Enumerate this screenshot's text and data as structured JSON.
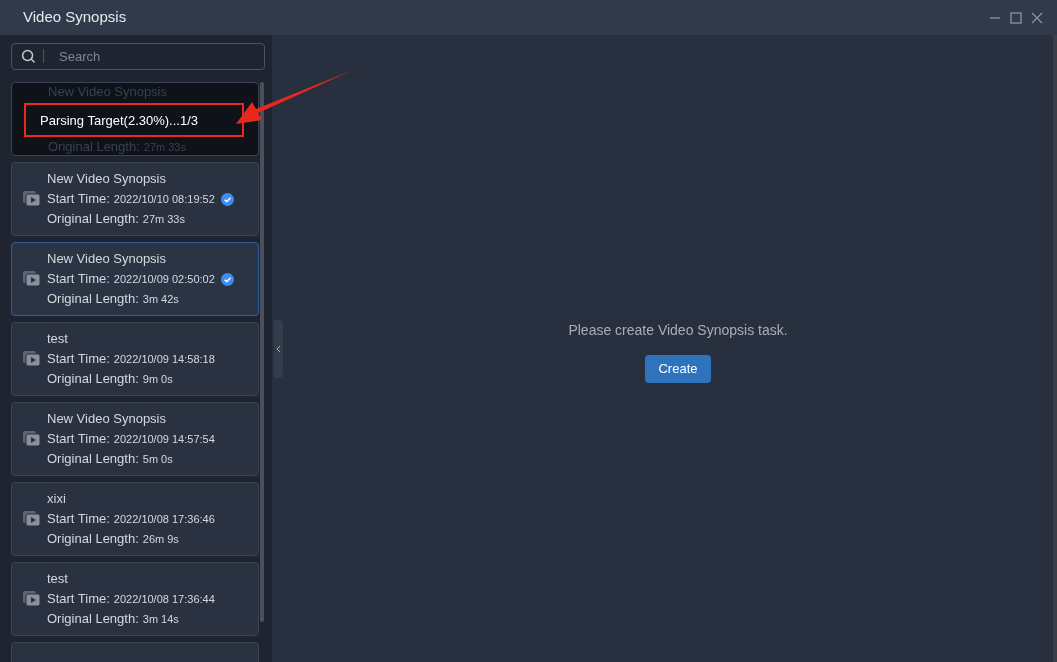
{
  "window": {
    "title": "Video Synopsis"
  },
  "search": {
    "placeholder": "Search"
  },
  "tasks": [
    {
      "name": "New Video Synopsis",
      "length_label": "Original Length:",
      "length": "27m 33s",
      "processing": true,
      "progress_text": "Parsing Target(2.30%)...1/3",
      "checked": false,
      "selected": false
    },
    {
      "name": "New Video Synopsis",
      "start_label": "Start Time:",
      "start_time": "2022/10/10 08:19:52",
      "length_label": "Original Length:",
      "length": "27m 33s",
      "processing": false,
      "checked": true,
      "selected": false
    },
    {
      "name": "New Video Synopsis",
      "start_label": "Start Time:",
      "start_time": "2022/10/09 02:50:02",
      "length_label": "Original Length:",
      "length": "3m 42s",
      "processing": false,
      "checked": true,
      "selected": true
    },
    {
      "name": "test",
      "start_label": "Start Time:",
      "start_time": "2022/10/09 14:58:18",
      "length_label": "Original Length:",
      "length": "9m 0s",
      "processing": false,
      "checked": false,
      "selected": false
    },
    {
      "name": "New Video Synopsis",
      "start_label": "Start Time:",
      "start_time": "2022/10/09 14:57:54",
      "length_label": "Original Length:",
      "length": "5m 0s",
      "processing": false,
      "checked": false,
      "selected": false
    },
    {
      "name": "xixi",
      "start_label": "Start Time:",
      "start_time": "2022/10/08 17:36:46",
      "length_label": "Original Length:",
      "length": "26m 9s",
      "processing": false,
      "checked": false,
      "selected": false
    },
    {
      "name": "test",
      "start_label": "Start Time:",
      "start_time": "2022/10/08 17:36:44",
      "length_label": "Original Length:",
      "length": "3m 14s",
      "processing": false,
      "checked": false,
      "selected": false
    }
  ],
  "empty_state": {
    "message": "Please create Video Synopsis task.",
    "button": "Create"
  }
}
